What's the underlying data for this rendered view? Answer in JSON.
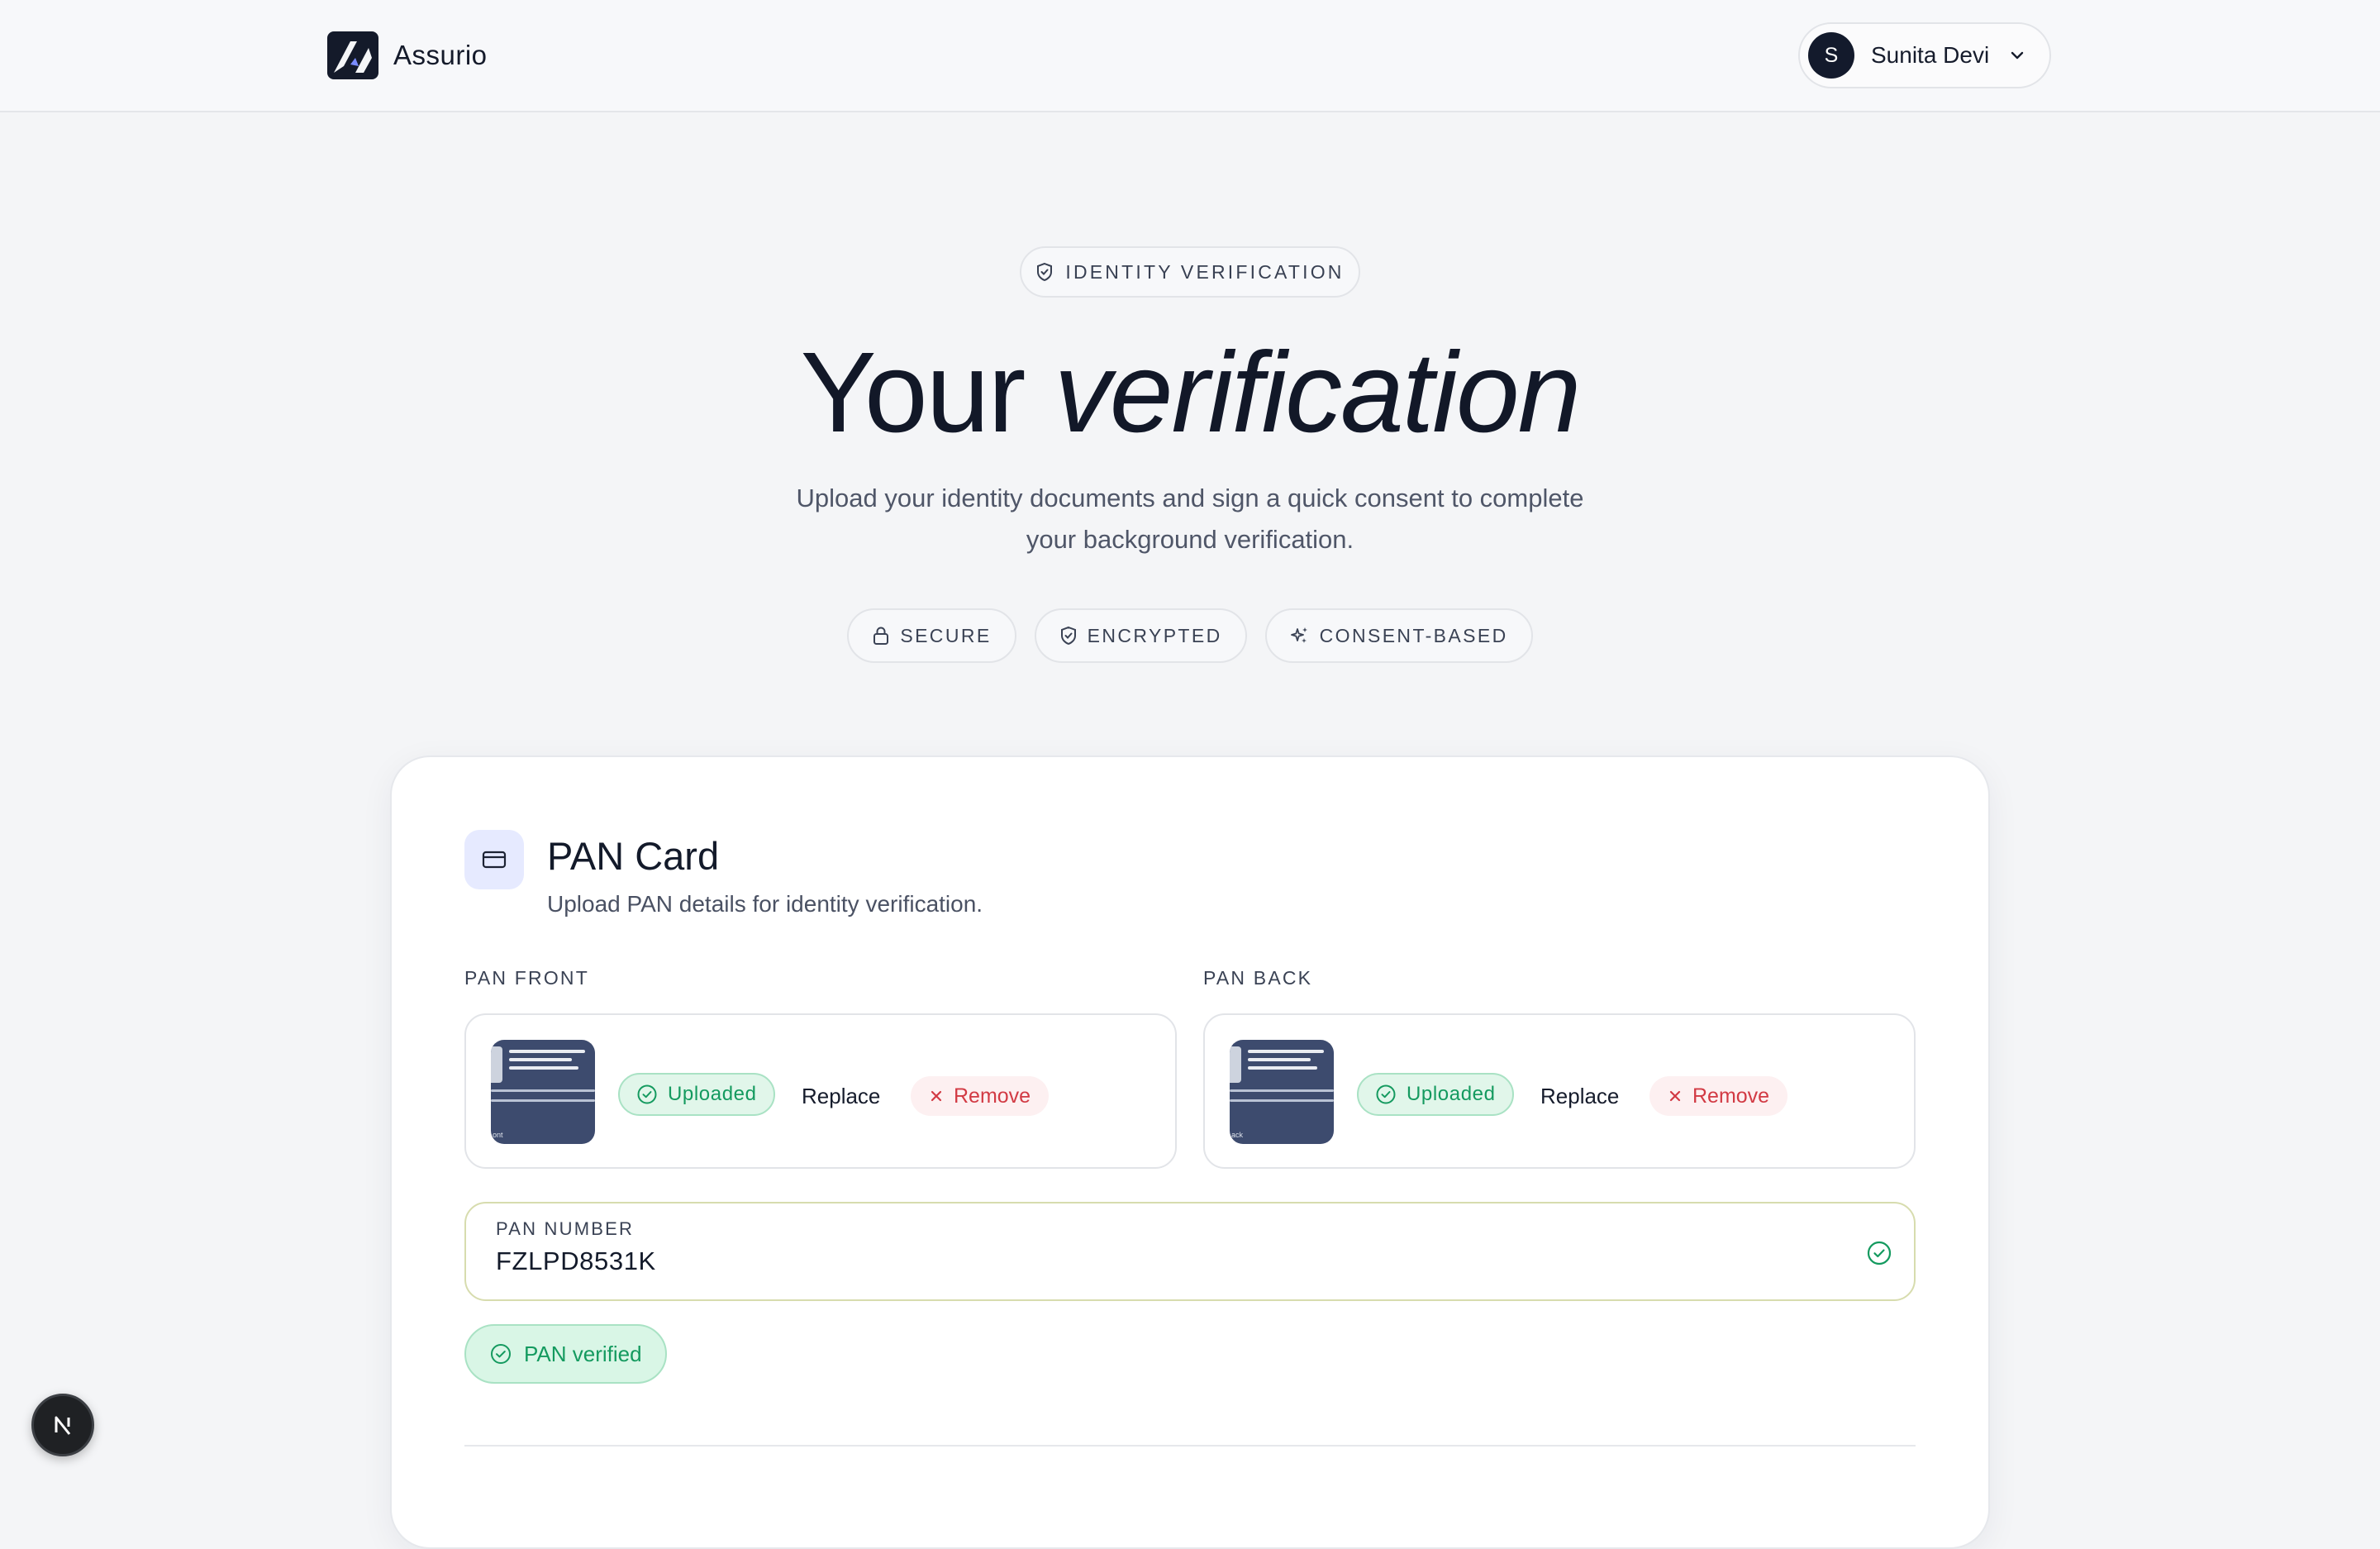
{
  "header": {
    "brand": "Assurio",
    "user": {
      "initial": "S",
      "name": "Sunita Devi"
    }
  },
  "hero": {
    "eyebrow": "IDENTITY VERIFICATION",
    "title_plain": "Your",
    "title_italic": "verification",
    "subtitle_line1": "Upload your identity documents and sign a quick consent to complete",
    "subtitle_line2": "your background verification.",
    "pills": [
      "SECURE",
      "ENCRYPTED",
      "CONSENT-BASED"
    ]
  },
  "pan_card": {
    "title": "PAN Card",
    "subtitle": "Upload PAN details for identity verification.",
    "front": {
      "label": "PAN FRONT",
      "thumb_caption": "ont",
      "status": "Uploaded",
      "replace": "Replace",
      "remove": "Remove"
    },
    "back": {
      "label": "PAN BACK",
      "thumb_caption": "ack",
      "status": "Uploaded",
      "replace": "Replace",
      "remove": "Remove"
    },
    "pan_number": {
      "label": "PAN NUMBER",
      "value": "FZLPD8531K"
    },
    "verified": "PAN verified"
  },
  "colors": {
    "accent_navy": "#131a2c",
    "success_green": "#149a5f",
    "danger_red": "#d23a44",
    "icon_bg": "#e6eaff"
  },
  "icons": [
    "logo-icon",
    "chevron-down-icon",
    "shield-check-icon",
    "lock-icon",
    "sparkle-icon",
    "card-icon",
    "check-circle-icon",
    "close-icon",
    "nextjs-icon"
  ]
}
